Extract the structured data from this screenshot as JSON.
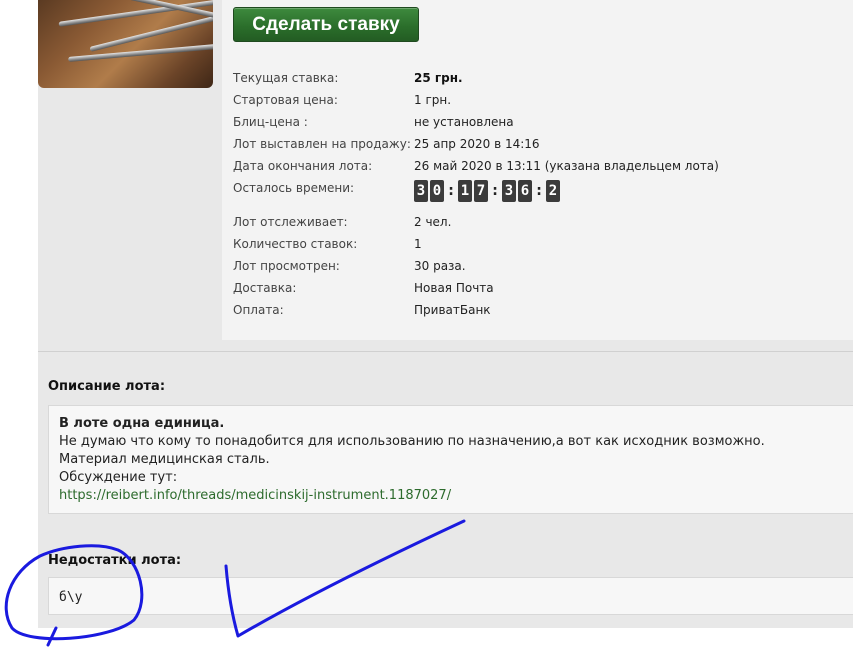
{
  "bid_button_label": "Сделать ставку",
  "details": [
    {
      "label": "Текущая ставка:",
      "value": "25 грн.",
      "bold": true
    },
    {
      "label": "Стартовая цена:",
      "value": "1 грн."
    },
    {
      "label": "Блиц-цена :",
      "value": "не установлена"
    },
    {
      "label": "Лот выставлен на продажу:",
      "value": "25 апр 2020 в 14:16"
    },
    {
      "label": "Дата окончания лота:",
      "value": "26 май 2020 в 13:11 (указана владельцем лота)"
    }
  ],
  "time_left": {
    "label": "Осталось времени:",
    "days": [
      "3",
      "0"
    ],
    "hours": [
      "1",
      "7"
    ],
    "minutes": [
      "3",
      "6"
    ],
    "seconds": [
      "2"
    ],
    "separator": ":"
  },
  "stats": [
    {
      "label": "Лот отслеживает:",
      "value": "2 чел."
    },
    {
      "label": "Количество ставок:",
      "value": "1"
    },
    {
      "label": "Лот просмотрен:",
      "value": "30 раза."
    },
    {
      "label": "Доставка:",
      "value": "Новая Почта"
    },
    {
      "label": "Оплата:",
      "value": "ПриватБанк"
    }
  ],
  "description": {
    "title": "Описание лота:",
    "headline": "В лоте одна единица.",
    "line1": "Не думаю что кому то понадобится для использованию по назначению,а вот как исходник возможно.",
    "line2": "Материал медицинская сталь.",
    "line3": "Обсуждение тут:",
    "link": "https://reibert.info/threads/medicinskij-instrument.1187027/"
  },
  "flaws": {
    "title": "Недостатки лота:",
    "text": "б\\у"
  },
  "annotation_color": "#1a1adf"
}
